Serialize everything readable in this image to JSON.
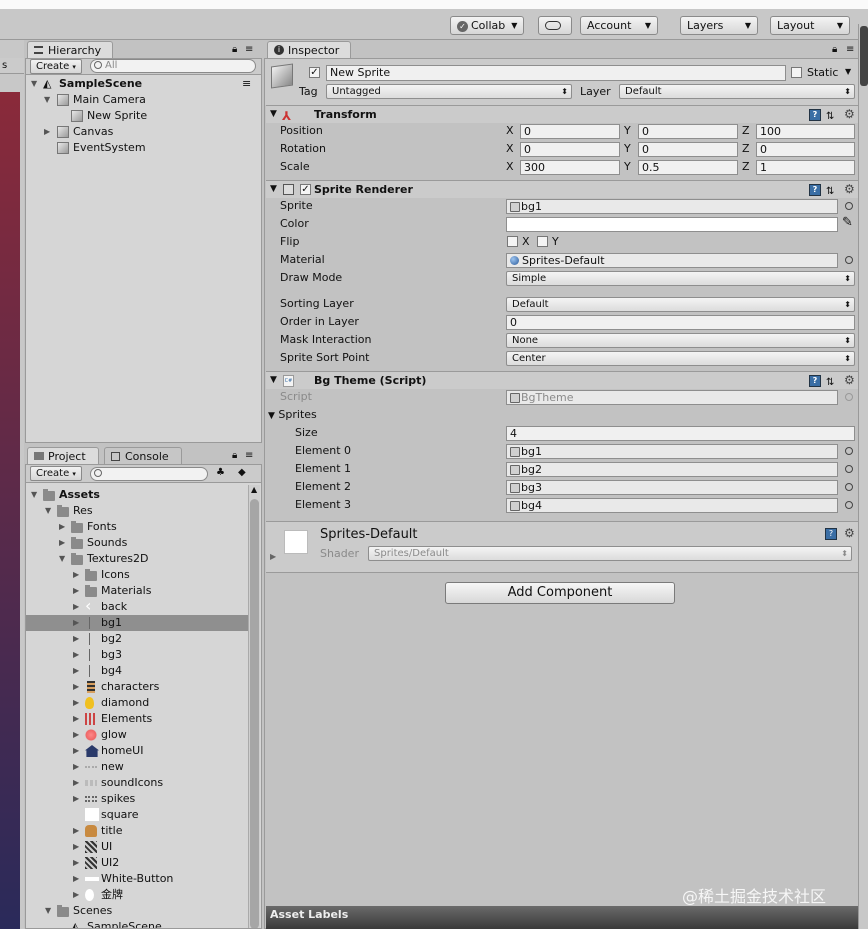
{
  "toolbar": {
    "collab": "Collab",
    "account": "Account",
    "layers": "Layers",
    "layout": "Layout"
  },
  "left_edge_fragment": "s",
  "hierarchy": {
    "tab": "Hierarchy",
    "create": "Create",
    "search_placeholder": "All",
    "scene": "SampleScene",
    "items": [
      "Main Camera",
      "New Sprite",
      "Canvas",
      "EventSystem"
    ]
  },
  "project": {
    "tab": "Project",
    "console_tab": "Console",
    "create": "Create",
    "tree": [
      {
        "label": "Assets",
        "bold": true
      },
      {
        "label": "Res"
      },
      {
        "label": "Fonts"
      },
      {
        "label": "Sounds"
      },
      {
        "label": "Textures2D"
      },
      {
        "label": "Icons"
      },
      {
        "label": "Materials"
      },
      {
        "label": "back"
      },
      {
        "label": "bg1"
      },
      {
        "label": "bg2"
      },
      {
        "label": "bg3"
      },
      {
        "label": "bg4"
      },
      {
        "label": "characters"
      },
      {
        "label": "diamond"
      },
      {
        "label": "Elements"
      },
      {
        "label": "glow"
      },
      {
        "label": "homeUI"
      },
      {
        "label": "new"
      },
      {
        "label": "soundIcons"
      },
      {
        "label": "spikes"
      },
      {
        "label": "square"
      },
      {
        "label": "title"
      },
      {
        "label": "UI"
      },
      {
        "label": "UI2"
      },
      {
        "label": "White-Button"
      },
      {
        "label": "金牌"
      },
      {
        "label": "Scenes"
      },
      {
        "label": "SampleScene"
      }
    ]
  },
  "inspector": {
    "tab": "Inspector",
    "object_name": "New Sprite",
    "static_label": "Static",
    "tag_label": "Tag",
    "tag_value": "Untagged",
    "layer_label": "Layer",
    "layer_value": "Default",
    "transform": {
      "title": "Transform",
      "position_label": "Position",
      "rotation_label": "Rotation",
      "scale_label": "Scale",
      "x": "X",
      "y": "Y",
      "z": "Z",
      "position": [
        "0",
        "0",
        "100"
      ],
      "rotation": [
        "0",
        "0",
        "0"
      ],
      "scale": [
        "300",
        "0.5",
        "1"
      ]
    },
    "sprite_renderer": {
      "title": "Sprite Renderer",
      "sprite_label": "Sprite",
      "sprite_value": "bg1",
      "color_label": "Color",
      "flip_label": "Flip",
      "flip_x": "X",
      "flip_y": "Y",
      "material_label": "Material",
      "material_value": "Sprites-Default",
      "draw_mode_label": "Draw Mode",
      "draw_mode_value": "Simple",
      "sorting_layer_label": "Sorting Layer",
      "sorting_layer_value": "Default",
      "order_label": "Order in Layer",
      "order_value": "0",
      "mask_label": "Mask Interaction",
      "mask_value": "None",
      "sort_point_label": "Sprite Sort Point",
      "sort_point_value": "Center"
    },
    "bg_theme": {
      "title": "Bg Theme (Script)",
      "script_label": "Script",
      "script_value": "BgTheme",
      "sprites_label": "Sprites",
      "size_label": "Size",
      "size_value": "4",
      "elements": [
        {
          "label": "Element 0",
          "value": "bg1"
        },
        {
          "label": "Element 1",
          "value": "bg2"
        },
        {
          "label": "Element 2",
          "value": "bg3"
        },
        {
          "label": "Element 3",
          "value": "bg4"
        }
      ]
    },
    "material": {
      "name": "Sprites-Default",
      "shader_label": "Shader",
      "shader_value": "Sprites/Default"
    },
    "add_component": "Add Component",
    "asset_labels": "Asset Labels"
  },
  "watermark": "@稀土掘金技术社区",
  "colors": {
    "accent_blue": "#3a6ea5",
    "selection": "#8f8f8f",
    "panel_bg": "#d6d6d6",
    "scene_edge_top": "#8a2a3a",
    "scene_edge_bottom": "#2a2a5a"
  }
}
